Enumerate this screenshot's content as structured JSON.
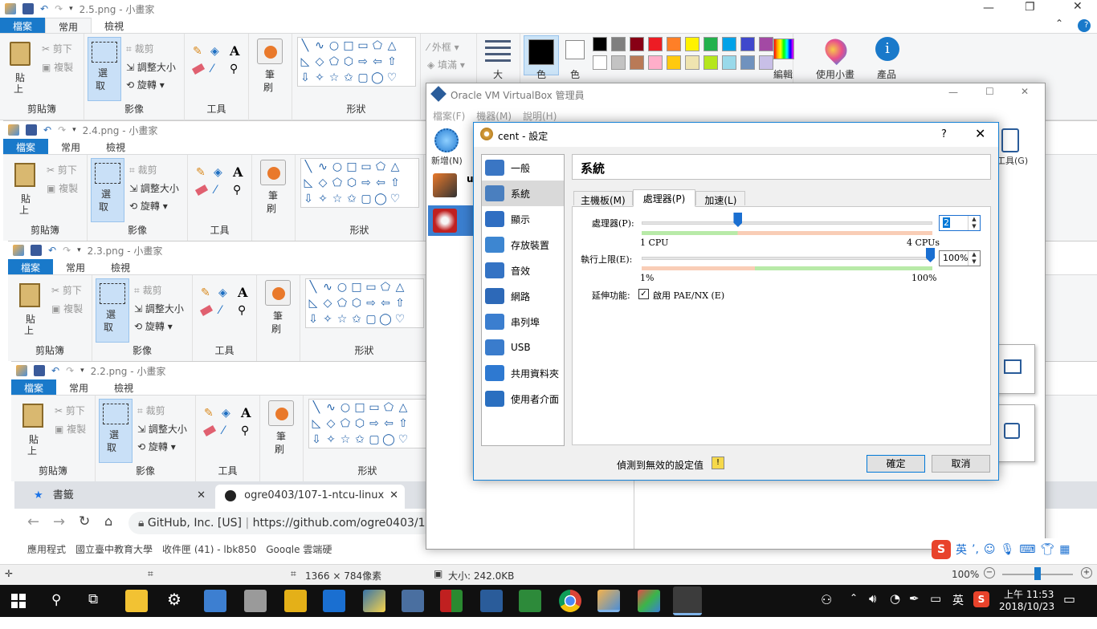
{
  "paint_windows": [
    {
      "title": "2.5.png - 小畫家"
    },
    {
      "title": "2.4.png - 小畫家"
    },
    {
      "title": "2.3.png - 小畫家"
    },
    {
      "title": "2.2.png - 小畫家"
    }
  ],
  "paint_ribbon": {
    "tab_file": "檔案",
    "tab_home": "常用",
    "tab_view": "檢視",
    "paste": "貼",
    "paste_sub": "上",
    "cut": "剪下",
    "copy": "複製",
    "clipboard": "剪貼簿",
    "select": "選",
    "select_sub": "取",
    "crop": "裁剪",
    "resize": "調整大小",
    "rotate": "旋轉",
    "image": "影像",
    "tools": "工具",
    "brush": "筆",
    "brush_sub": "刷",
    "shapes": "形狀",
    "outline": "外框",
    "fill": "填滿",
    "size": "大",
    "color1": "色",
    "color2": "色",
    "edit_colors": "編輯",
    "use_paint3d": "使用小畫",
    "product": "產品"
  },
  "palette": [
    "#000000",
    "#7f7f7f",
    "#880015",
    "#ed1c24",
    "#ff7f27",
    "#fff200",
    "#22b14c",
    "#00a2e8",
    "#3f48cc",
    "#a349a4",
    "#ffffff",
    "#c3c3c3",
    "#b97a57",
    "#ffaec9",
    "#ffc90e",
    "#efe4b0",
    "#b5e61d",
    "#99d9ea",
    "#7092be",
    "#c8bfe7"
  ],
  "vbox": {
    "title": "Oracle VM VirtualBox 管理員",
    "menu": [
      "檔案(F)",
      "機器(M)",
      "說明(H)"
    ],
    "new_label": "新增(N)",
    "tools_label": "工具(G)",
    "vm_letter": "u"
  },
  "dialog": {
    "title": "cent - 設定",
    "help": "?",
    "section_title": "系統",
    "nav": [
      {
        "label": "一般",
        "color": "#3a76c4"
      },
      {
        "label": "系統",
        "color": "#4a7fbf"
      },
      {
        "label": "顯示",
        "color": "#2f6ec2"
      },
      {
        "label": "存放裝置",
        "color": "#3d86d1"
      },
      {
        "label": "音效",
        "color": "#3473c4"
      },
      {
        "label": "網路",
        "color": "#2d69b8"
      },
      {
        "label": "串列埠",
        "color": "#3b7ecf"
      },
      {
        "label": "USB",
        "color": "#3a7ccc"
      },
      {
        "label": "共用資料夾",
        "color": "#2e79d1"
      },
      {
        "label": "使用者介面",
        "color": "#2a6fc0"
      }
    ],
    "tabs": [
      "主機板(M)",
      "處理器(P)",
      "加速(L)"
    ],
    "processor_label": "處理器(P):",
    "processor_value": "2",
    "processor_level": 0.33,
    "processor_min": "1 CPU",
    "processor_max": "4 CPUs",
    "exec_cap_label": "執行上限(E):",
    "exec_cap_value": "100%",
    "exec_cap_min": "1%",
    "exec_cap_max": "100%",
    "ext_label": "延伸功能:",
    "pae_label": "啟用 PAE/NX (E)",
    "invalid_msg": "偵測到無效的設定值",
    "ok": "確定",
    "cancel": "取消"
  },
  "browser": {
    "tab1": "書籤",
    "tab2": "ogre0403/107-1-ntcu-linux",
    "site": "GitHub, Inc. [US]",
    "url": "https://github.com/ogre0403/10",
    "bookmarks": "應用程式　國立臺中教育大學　收件匣 (41) - lbk850　Google 雲端硬"
  },
  "paint_status": {
    "dimensions": "1366 × 784像素",
    "filesize": "大小: 242.0KB",
    "zoom": "100%"
  },
  "ime": {
    "lang": "英"
  },
  "taskbar": {
    "time": "上午 11:53",
    "date": "2018/10/23",
    "lang": "英"
  }
}
